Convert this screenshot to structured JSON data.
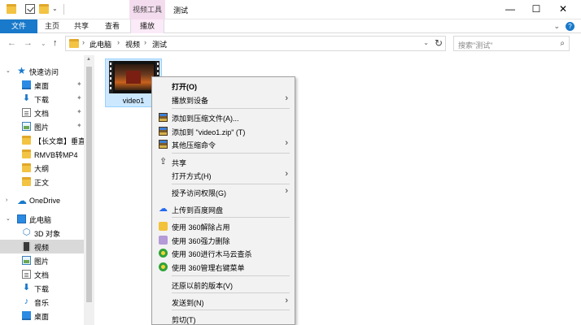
{
  "window": {
    "title": "测试",
    "context_tool_tab": "视频工具",
    "minimize_glyph": "—",
    "maximize_glyph": "☐",
    "close_glyph": "✕"
  },
  "ribbon": {
    "tabs": [
      "文件",
      "主页",
      "共享",
      "查看",
      "播放"
    ],
    "collapse_glyph": "⌄",
    "help_glyph": "?"
  },
  "address": {
    "crumbs": [
      "此电脑",
      "视频",
      "测试"
    ],
    "separator": "›",
    "dropdown_glyph": "⌄",
    "refresh_glyph": "↻",
    "nav": {
      "back": "←",
      "forward": "→",
      "recent": "⌄",
      "up": "↑"
    }
  },
  "search": {
    "placeholder": "搜索\"测试\"",
    "icon": "search-icon",
    "glyph": "⌕"
  },
  "sidebar": {
    "pin_glyph": "✦",
    "items": [
      {
        "label": "快速访问",
        "icon": "star-icon",
        "glyph": "★"
      },
      {
        "label": "桌面",
        "icon": "desktop-icon"
      },
      {
        "label": "下载",
        "icon": "download-icon",
        "glyph": "⬇"
      },
      {
        "label": "文档",
        "icon": "document-icon"
      },
      {
        "label": "图片",
        "icon": "picture-icon"
      },
      {
        "label": "【长文章】垂直",
        "icon": "folder-icon"
      },
      {
        "label": "RMVB转MP4",
        "icon": "folder-icon"
      },
      {
        "label": "大纲",
        "icon": "folder-icon"
      },
      {
        "label": "正文",
        "icon": "folder-icon"
      },
      {
        "label": "OneDrive",
        "icon": "cloud-icon",
        "glyph": "☁"
      },
      {
        "label": "此电脑",
        "icon": "computer-icon"
      },
      {
        "label": "3D 对象",
        "icon": "cube-icon",
        "glyph": "⬡"
      },
      {
        "label": "视频",
        "icon": "video-icon"
      },
      {
        "label": "图片",
        "icon": "picture-icon"
      },
      {
        "label": "文档",
        "icon": "document-icon"
      },
      {
        "label": "下载",
        "icon": "download-icon",
        "glyph": "⬇"
      },
      {
        "label": "音乐",
        "icon": "music-icon",
        "glyph": "♪"
      },
      {
        "label": "桌面",
        "icon": "desktop-icon"
      }
    ]
  },
  "files": [
    {
      "name": "video1",
      "type": "video"
    }
  ],
  "context_menu": {
    "items": [
      {
        "label": "打开(O)",
        "bold": true
      },
      {
        "label": "播放到设备",
        "submenu": true
      },
      {
        "label": "添加到压缩文件(A)...",
        "icon": "winrar-icon"
      },
      {
        "label": "添加到 \"video1.zip\" (T)",
        "icon": "winrar-icon"
      },
      {
        "label": "其他压缩命令",
        "icon": "winrar-icon",
        "submenu": true
      },
      {
        "label": "共享",
        "icon": "share-icon",
        "glyph": "⇪"
      },
      {
        "label": "打开方式(H)",
        "submenu": true
      },
      {
        "label": "授予访问权限(G)",
        "submenu": true
      },
      {
        "label": "上传到百度网盘",
        "icon": "baidu-netdisk-icon",
        "glyph": "☁"
      },
      {
        "label": "使用 360解除占用",
        "icon": "360-unlock-icon"
      },
      {
        "label": "使用 360强力删除",
        "icon": "360-delete-icon"
      },
      {
        "label": "使用 360进行木马云查杀",
        "icon": "360-scan-icon"
      },
      {
        "label": "使用 360管理右键菜单",
        "icon": "360-manage-icon"
      },
      {
        "label": "还原以前的版本(V)"
      },
      {
        "label": "发送到(N)",
        "submenu": true
      },
      {
        "label": "剪切(T)"
      }
    ],
    "submenu_glyph": "›"
  },
  "colors": {
    "accent": "#1979ca",
    "selection": "#cce8ff",
    "context_tab": "#f4dcef",
    "menu_bg": "#f2f2f2"
  }
}
